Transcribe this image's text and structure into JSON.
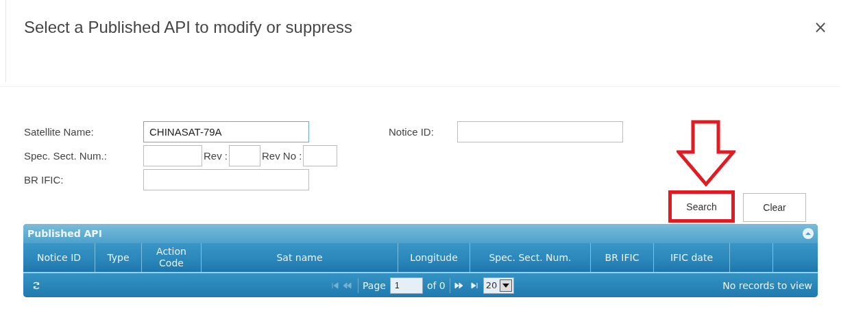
{
  "dialog": {
    "title": "Select a Published API to modify or suppress",
    "close": "×"
  },
  "form": {
    "satellite_name": {
      "label": "Satellite Name:",
      "value": "CHINASAT-79A"
    },
    "notice_id": {
      "label": "Notice ID:"
    },
    "spec_sect_num": {
      "label": "Spec. Sect. Num.:"
    },
    "rev": {
      "label": "Rev :"
    },
    "rev_no": {
      "label": "Rev No :"
    },
    "br_ific": {
      "label": "BR IFIC:"
    }
  },
  "buttons": [
    {
      "label": "Search",
      "highlighted": true
    },
    {
      "label": "Clear",
      "highlighted": false
    }
  ],
  "grid": {
    "caption": "Published API",
    "columns": [
      {
        "label": "Notice ID"
      },
      {
        "label": "Type"
      },
      {
        "label": "Action Code"
      },
      {
        "label": "Sat name"
      },
      {
        "label": "Longitude"
      },
      {
        "label": "Spec. Sect. Num."
      },
      {
        "label": "BR IFIC"
      },
      {
        "label": "IFIC date"
      }
    ],
    "pager": {
      "page_label": "Page",
      "page": "1",
      "of": "of 0",
      "page_size": "20",
      "status": "No records to view"
    }
  }
}
